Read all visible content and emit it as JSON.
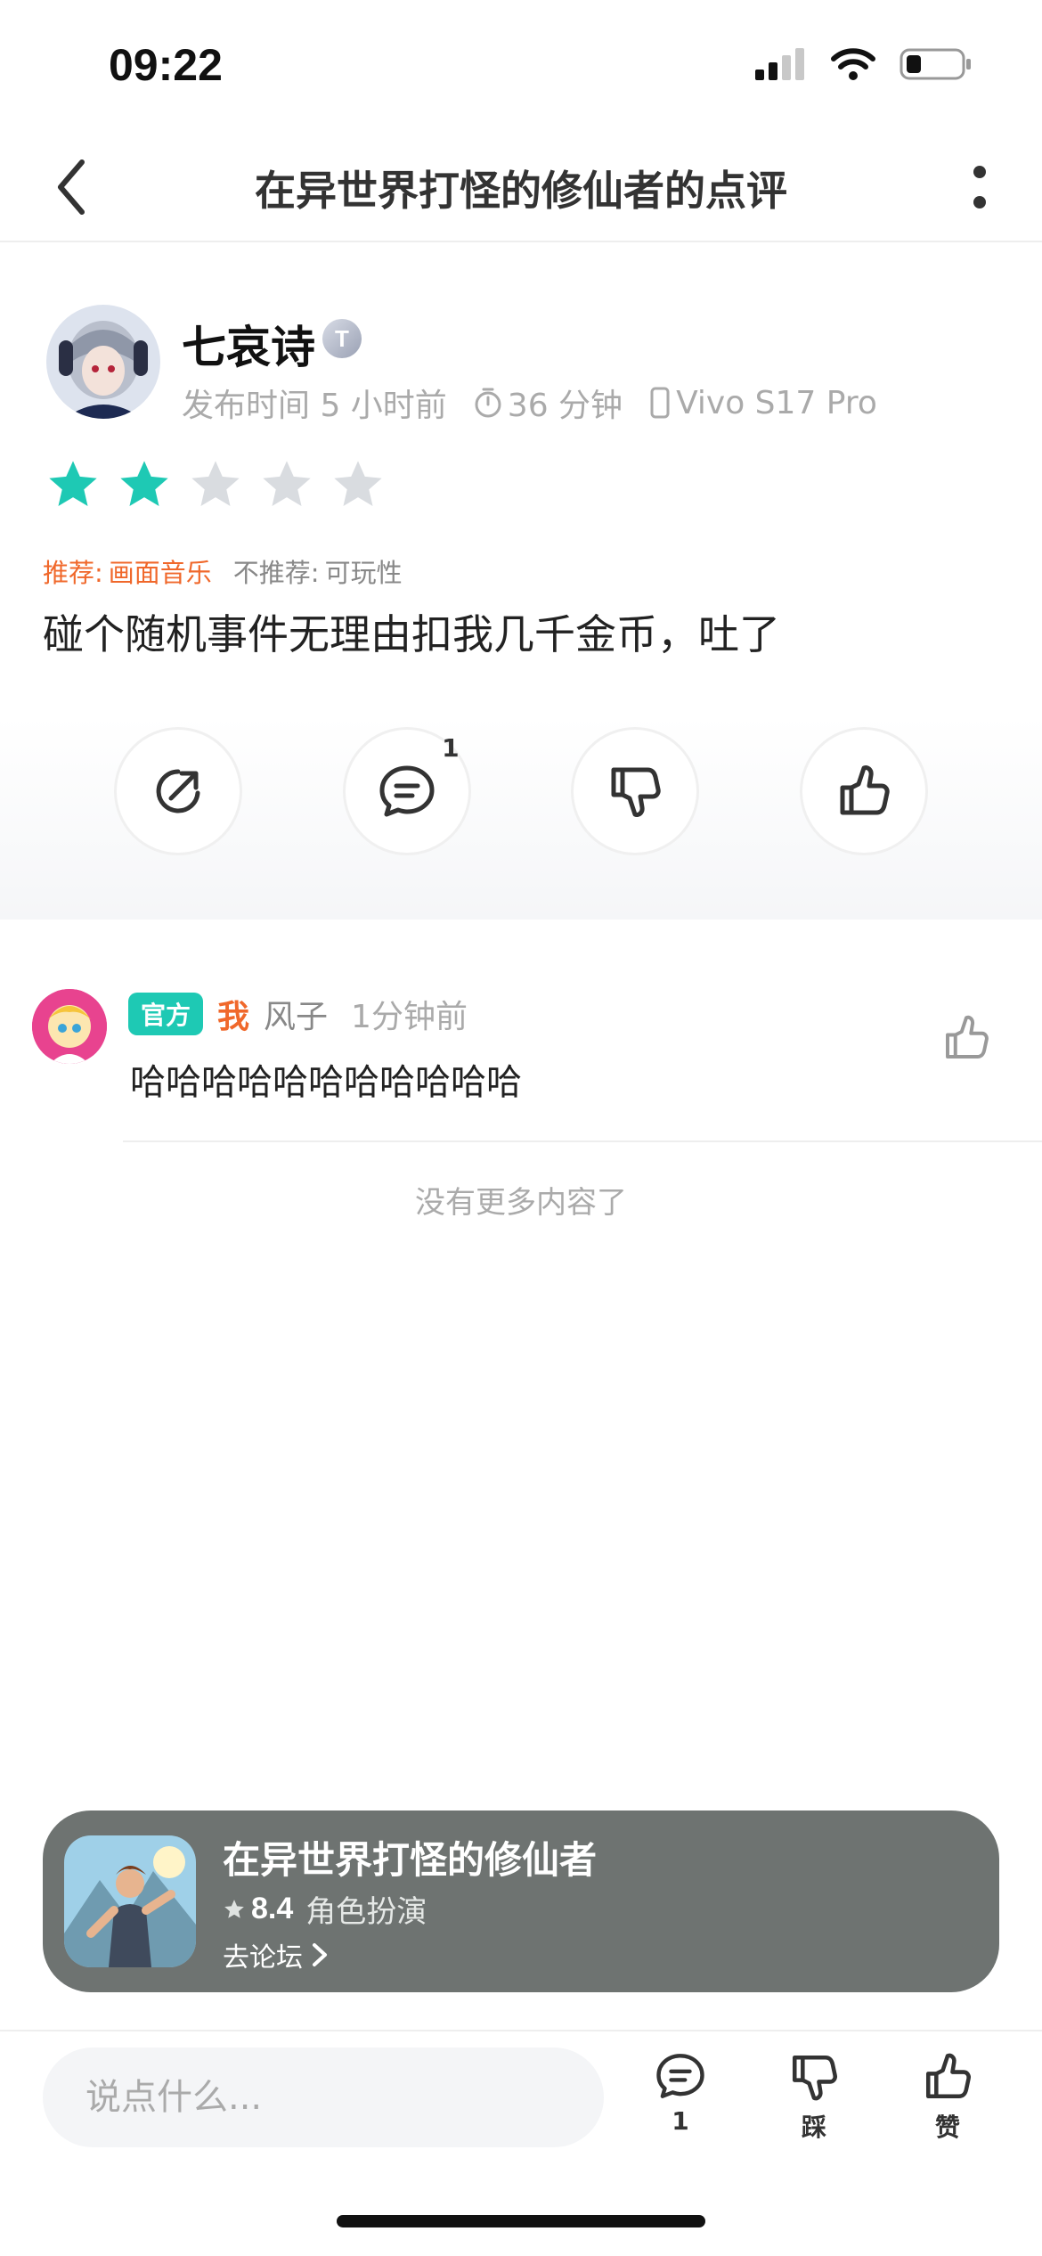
{
  "status_bar": {
    "time": "09:22"
  },
  "nav": {
    "title": "在异世界打怪的修仙者的点评"
  },
  "review": {
    "user_name": "七哀诗",
    "level_badge": "T",
    "publish_time": "发布时间 5 小时前",
    "play_time": "36 分钟",
    "device": "Vivo S17 Pro",
    "rating": 2,
    "rating_max": 5,
    "recommend_label": "推荐:",
    "recommend_value": "画面音乐",
    "not_recommend_label": "不推荐:",
    "not_recommend_value": "可玩性",
    "text": "碰个随机事件无理由扣我几千金币，吐了",
    "actions": {
      "comment_count": "1"
    }
  },
  "comment": {
    "official_badge": "官方",
    "me_label": "我",
    "user": "风子",
    "time": "1分钟前",
    "text": "哈哈哈哈哈哈哈哈哈哈哈"
  },
  "no_more": "没有更多内容了",
  "game_card": {
    "name": "在异世界打怪的修仙者",
    "score": "8.4",
    "genre": "角色扮演",
    "link": "去论坛"
  },
  "bottom_bar": {
    "input_placeholder": "说点什么...",
    "comment_count": "1",
    "dislike_label": "踩",
    "like_label": "赞"
  },
  "colors": {
    "accent": "#1ec9b4",
    "recommend": "#f0682b",
    "star_off": "#d9dce0",
    "card_bg": "#6e7371"
  }
}
